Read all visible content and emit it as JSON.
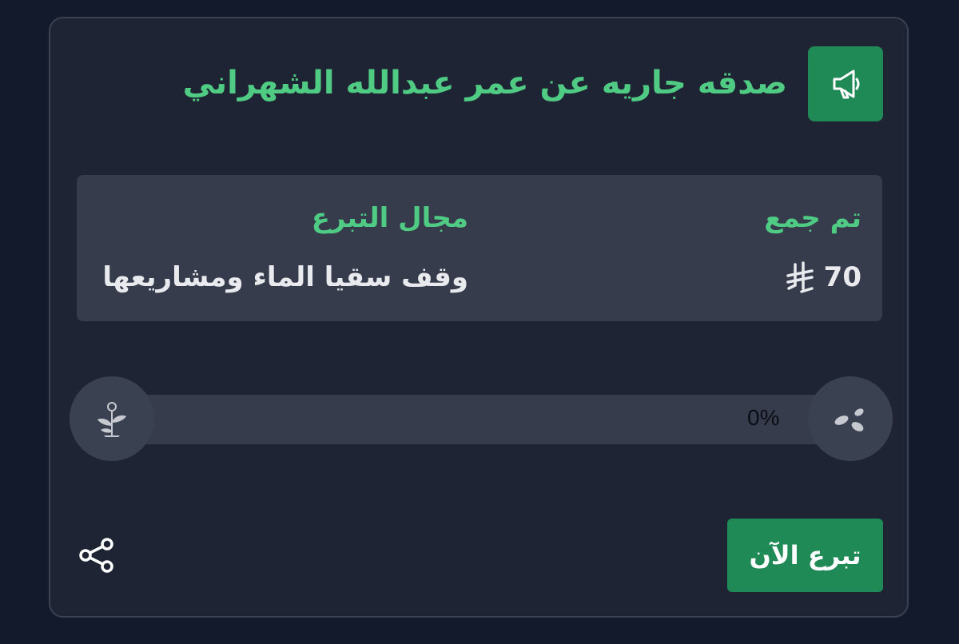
{
  "card": {
    "title": "صدقه جاريه عن عمر عبدالله الشهراني",
    "header_icon": "megaphone-icon"
  },
  "info": {
    "collected_label": "تم جمع",
    "collected_amount": "70",
    "currency_icon": "saudi-riyal-icon",
    "field_label": "مجال التبرع",
    "field_value": "وقف سقيا الماء ومشاريعها"
  },
  "progress": {
    "percent_text": "0%",
    "fraction": 0,
    "start_icon": "seeds-icon",
    "end_icon": "plant-sprout-icon"
  },
  "actions": {
    "donate_label": "تبرع الآن",
    "share_icon": "share-icon"
  },
  "colors": {
    "background": "#131a2b",
    "card": "#1e2433",
    "accent": "#1f8a55",
    "accent_text": "#4fcb84",
    "panel": "#363c4c"
  }
}
